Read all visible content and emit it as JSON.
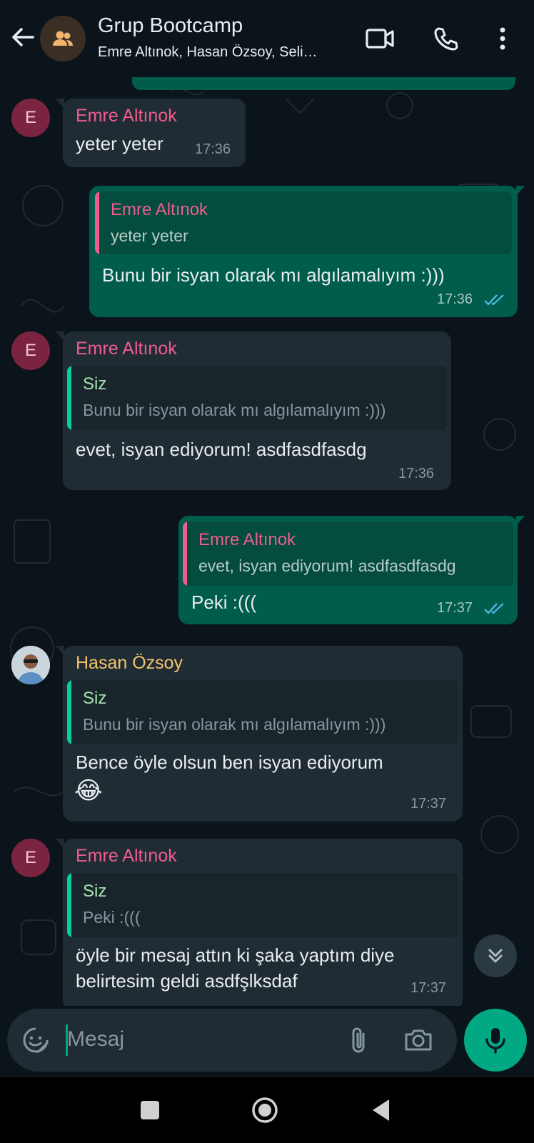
{
  "header": {
    "title": "Grup Bootcamp",
    "subtitle": "Emre Altınok, Hasan Özsoy, Seli…",
    "icons": [
      "back-arrow-icon",
      "group-icon",
      "video-call-icon",
      "phone-icon",
      "more-vert-icon"
    ]
  },
  "messages": [
    {
      "direction": "in",
      "avatar_letter": "E",
      "sender": "Emre Altınok",
      "text": "yeter yeter",
      "time": "17:36"
    },
    {
      "direction": "out",
      "quote": {
        "name": "Emre Altınok",
        "text": "yeter yeter"
      },
      "text": "Bunu bir isyan olarak mı algılamalıyım :)))",
      "time": "17:36"
    },
    {
      "direction": "in",
      "avatar_letter": "E",
      "sender": "Emre Altınok",
      "quote": {
        "name": "Siz",
        "text": "Bunu bir isyan olarak mı algılamalıyım :)))"
      },
      "text": "evet, isyan ediyorum! asdfasdfasdg",
      "time": "17:36"
    },
    {
      "direction": "out",
      "quote": {
        "name": "Emre Altınok",
        "text": "evet, isyan ediyorum! asdfasdfasdg"
      },
      "text": "Peki :(((",
      "time": "17:37"
    },
    {
      "direction": "in",
      "sender": "Hasan Özsoy",
      "quote": {
        "name": "Siz",
        "text": "Bunu bir isyan olarak mı algılamalıyım :)))"
      },
      "text": "Bence öyle olsun ben isyan ediyorum",
      "emoji": "😂",
      "time": "17:37"
    },
    {
      "direction": "in",
      "avatar_letter": "E",
      "sender": "Emre Altınok",
      "quote": {
        "name": "Siz",
        "text": "Peki :((("
      },
      "text_line1": "öyle bir mesaj attın ki şaka yaptım diye",
      "text_line2": "belirtesim geldi asdfşlksdaf",
      "time": "17:37"
    }
  ],
  "input": {
    "placeholder": "Mesaj"
  },
  "colors": {
    "background": "#0b141a",
    "incoming_bubble": "#1f2c34",
    "outgoing_bubble": "#005c4b",
    "emre_name": "#f15c8d",
    "hasan_name": "#f5c26b",
    "siz_name": "#a5e3b1",
    "accent_green": "#00a884",
    "read_ticks": "#53bdeb"
  }
}
